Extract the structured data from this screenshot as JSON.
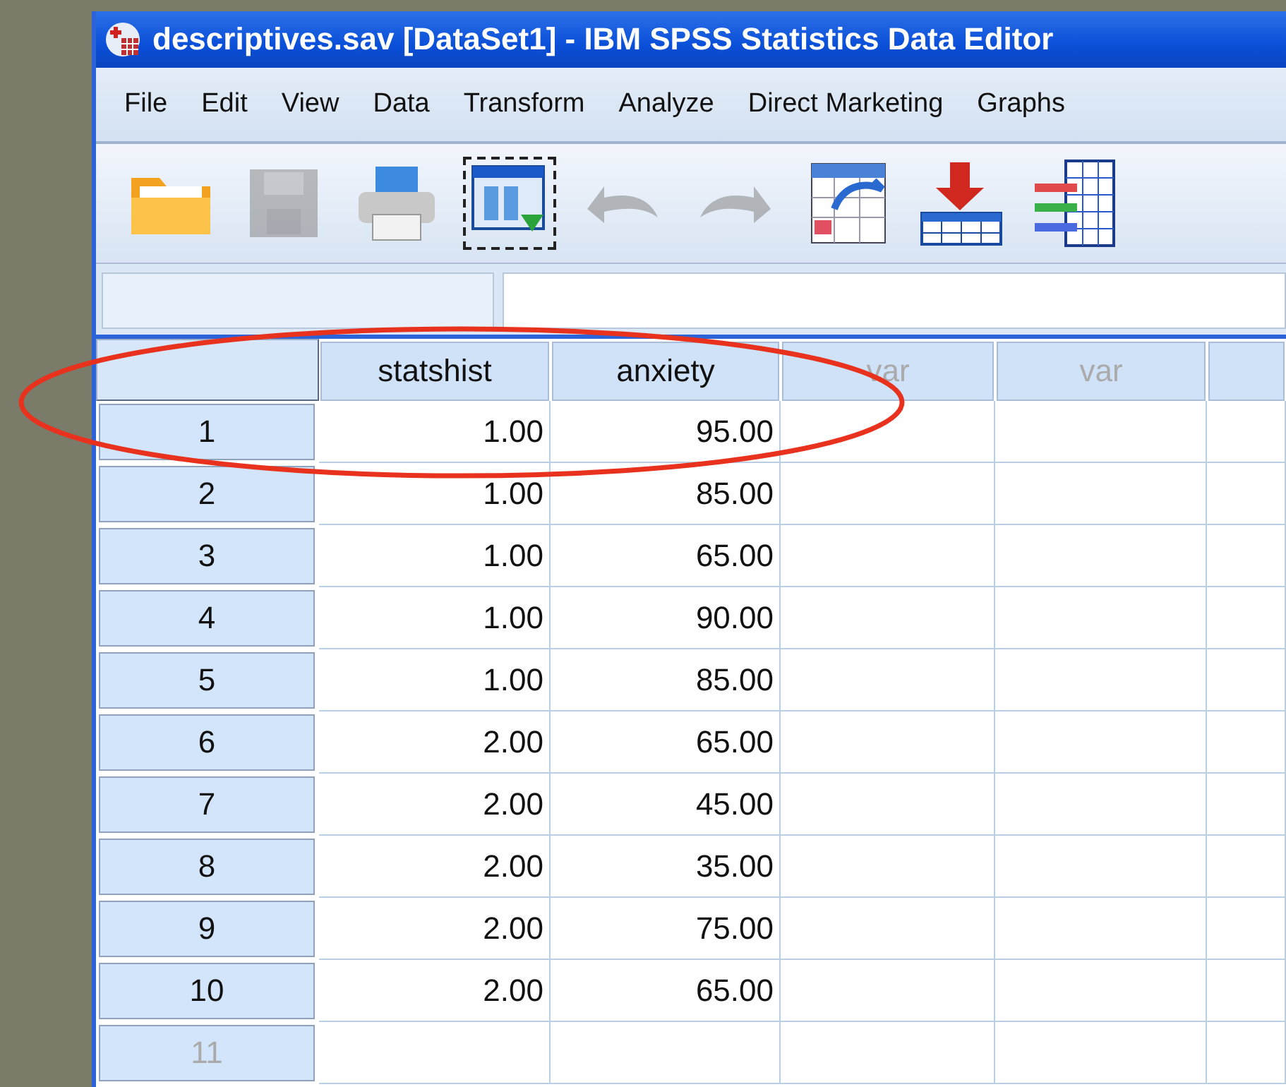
{
  "window": {
    "title": "descriptives.sav [DataSet1] - IBM SPSS Statistics Data Editor"
  },
  "menu": [
    {
      "label": "File"
    },
    {
      "label": "Edit"
    },
    {
      "label": "View"
    },
    {
      "label": "Data"
    },
    {
      "label": "Transform"
    },
    {
      "label": "Analyze"
    },
    {
      "label": "Direct Marketing"
    },
    {
      "label": "Graphs"
    }
  ],
  "toolbar": [
    {
      "kind": "folder",
      "disabled": false,
      "selected": false
    },
    {
      "kind": "floppy",
      "disabled": true,
      "selected": false
    },
    {
      "kind": "printer",
      "disabled": false,
      "selected": false
    },
    {
      "kind": "dialog",
      "disabled": false,
      "selected": true
    },
    {
      "kind": "undo",
      "disabled": true,
      "selected": false
    },
    {
      "kind": "redo",
      "disabled": true,
      "selected": false
    },
    {
      "kind": "goto",
      "disabled": false,
      "selected": false
    },
    {
      "kind": "insert",
      "disabled": false,
      "selected": false
    },
    {
      "kind": "variables",
      "disabled": false,
      "selected": false
    }
  ],
  "table": {
    "columns": [
      {
        "label": "statshist",
        "defined": true
      },
      {
        "label": "anxiety",
        "defined": true
      },
      {
        "label": "var",
        "defined": false
      },
      {
        "label": "var",
        "defined": false
      }
    ],
    "rows": [
      {
        "number": "1",
        "disabled": false,
        "cells": [
          "1.00",
          "95.00"
        ]
      },
      {
        "number": "2",
        "disabled": false,
        "cells": [
          "1.00",
          "85.00"
        ]
      },
      {
        "number": "3",
        "disabled": false,
        "cells": [
          "1.00",
          "65.00"
        ]
      },
      {
        "number": "4",
        "disabled": false,
        "cells": [
          "1.00",
          "90.00"
        ]
      },
      {
        "number": "5",
        "disabled": false,
        "cells": [
          "1.00",
          "85.00"
        ]
      },
      {
        "number": "6",
        "disabled": false,
        "cells": [
          "2.00",
          "65.00"
        ]
      },
      {
        "number": "7",
        "disabled": false,
        "cells": [
          "2.00",
          "45.00"
        ]
      },
      {
        "number": "8",
        "disabled": false,
        "cells": [
          "2.00",
          "35.00"
        ]
      },
      {
        "number": "9",
        "disabled": false,
        "cells": [
          "2.00",
          "75.00"
        ]
      },
      {
        "number": "10",
        "disabled": false,
        "cells": [
          "2.00",
          "65.00"
        ]
      },
      {
        "number": "11",
        "disabled": true,
        "cells": []
      }
    ]
  }
}
